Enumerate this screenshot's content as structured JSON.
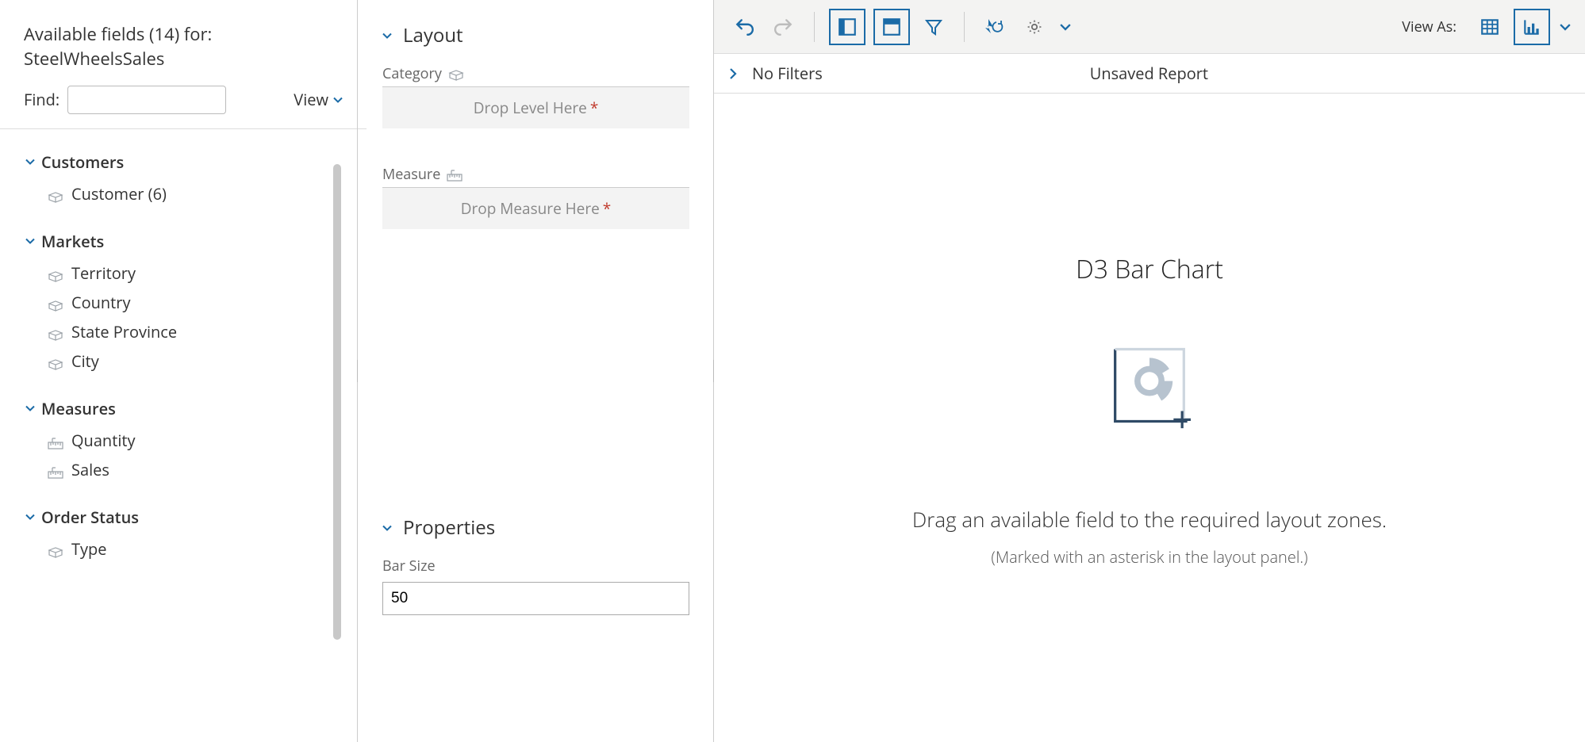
{
  "leftPanel": {
    "titlePrefix": "Available fields (14) for:",
    "source": "SteelWheelsSales",
    "findLabel": "Find:",
    "findValue": "",
    "viewLabel": "View",
    "groups": [
      {
        "name": "Customers",
        "items": [
          {
            "label": "Customer (6)",
            "icon": "cube"
          }
        ]
      },
      {
        "name": "Markets",
        "items": [
          {
            "label": "Territory",
            "icon": "cube"
          },
          {
            "label": "Country",
            "icon": "cube"
          },
          {
            "label": "State Province",
            "icon": "cube"
          },
          {
            "label": "City",
            "icon": "cube"
          }
        ]
      },
      {
        "name": "Measures",
        "items": [
          {
            "label": "Quantity",
            "icon": "ruler"
          },
          {
            "label": "Sales",
            "icon": "ruler"
          }
        ]
      },
      {
        "name": "Order Status",
        "items": [
          {
            "label": "Type",
            "icon": "cube"
          }
        ]
      }
    ]
  },
  "middlePanel": {
    "layoutHeader": "Layout",
    "categoryLabel": "Category",
    "dropLevel": "Drop Level Here",
    "measureLabel": "Measure",
    "dropMeasure": "Drop Measure Here",
    "propertiesHeader": "Properties",
    "barSizeLabel": "Bar Size",
    "barSizeValue": "50"
  },
  "rightPanel": {
    "viewAsLabel": "View As:",
    "filterToggleText": "No Filters",
    "reportTitle": "Unsaved Report",
    "canvasTitle": "D3 Bar Chart",
    "canvasMsg": "Drag an available field to the required layout zones.",
    "canvasSub": "(Marked with an asterisk in the layout panel.)"
  }
}
